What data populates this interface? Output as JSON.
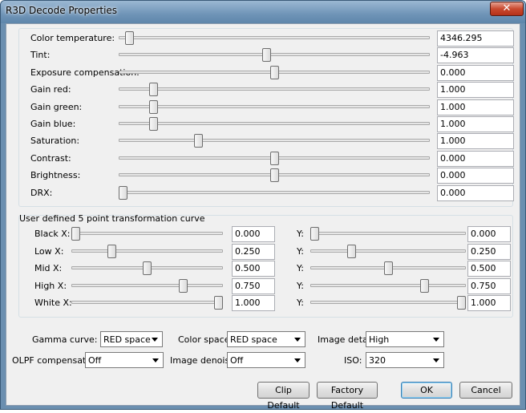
{
  "window": {
    "title": "R3D Decode Properties",
    "close_glyph": "✕"
  },
  "sliders": [
    {
      "label": "Color temperature:",
      "value": "4346.295",
      "pos": 0.02
    },
    {
      "label": "Tint:",
      "value": "-4.963",
      "pos": 0.475
    },
    {
      "label": "Exposure compensation:",
      "value": "0.000",
      "pos": 0.5
    },
    {
      "label": "Gain red:",
      "value": "1.000",
      "pos": 0.1
    },
    {
      "label": "Gain green:",
      "value": "1.000",
      "pos": 0.1
    },
    {
      "label": "Gain blue:",
      "value": "1.000",
      "pos": 0.1
    },
    {
      "label": "Saturation:",
      "value": "1.000",
      "pos": 0.25
    },
    {
      "label": "Contrast:",
      "value": "0.000",
      "pos": 0.5
    },
    {
      "label": "Brightness:",
      "value": "0.000",
      "pos": 0.5
    },
    {
      "label": "DRX:",
      "value": "0.000",
      "pos": 0.0
    }
  ],
  "curve": {
    "group_label": "User defined 5 point transformation curve",
    "points": [
      {
        "x_label": "Black X:",
        "x_value": "0.000",
        "x_pos": 0.0,
        "y_label": "Y:",
        "y_value": "0.000",
        "y_pos": 0.0
      },
      {
        "x_label": "Low X:",
        "x_value": "0.250",
        "x_pos": 0.25,
        "y_label": "Y:",
        "y_value": "0.250",
        "y_pos": 0.25
      },
      {
        "x_label": "Mid X:",
        "x_value": "0.500",
        "x_pos": 0.5,
        "y_label": "Y:",
        "y_value": "0.500",
        "y_pos": 0.5
      },
      {
        "x_label": "High X:",
        "x_value": "0.750",
        "x_pos": 0.75,
        "y_label": "Y:",
        "y_value": "0.750",
        "y_pos": 0.75
      },
      {
        "x_label": "White X:",
        "x_value": "1.000",
        "x_pos": 1.0,
        "y_label": "Y:",
        "y_value": "1.000",
        "y_pos": 1.0
      }
    ]
  },
  "options": {
    "gamma_curve": {
      "label": "Gamma curve:",
      "value": "RED space"
    },
    "color_space": {
      "label": "Color space:",
      "value": "RED space"
    },
    "image_detail": {
      "label": "Image detail:",
      "value": "High"
    },
    "olpf_compensation": {
      "label": "OLPF compensation:",
      "value": "Off"
    },
    "image_denoise": {
      "label": "Image denoise:",
      "value": "Off"
    },
    "iso": {
      "label": "ISO:",
      "value": "320"
    }
  },
  "buttons": {
    "clip_default": "Clip Default",
    "factory_default": "Factory Default",
    "ok": "OK",
    "cancel": "Cancel"
  },
  "colors": {
    "titlebar": "#6f94b7",
    "close": "#c9492f",
    "dialog_bg": "#f0f0f0"
  }
}
